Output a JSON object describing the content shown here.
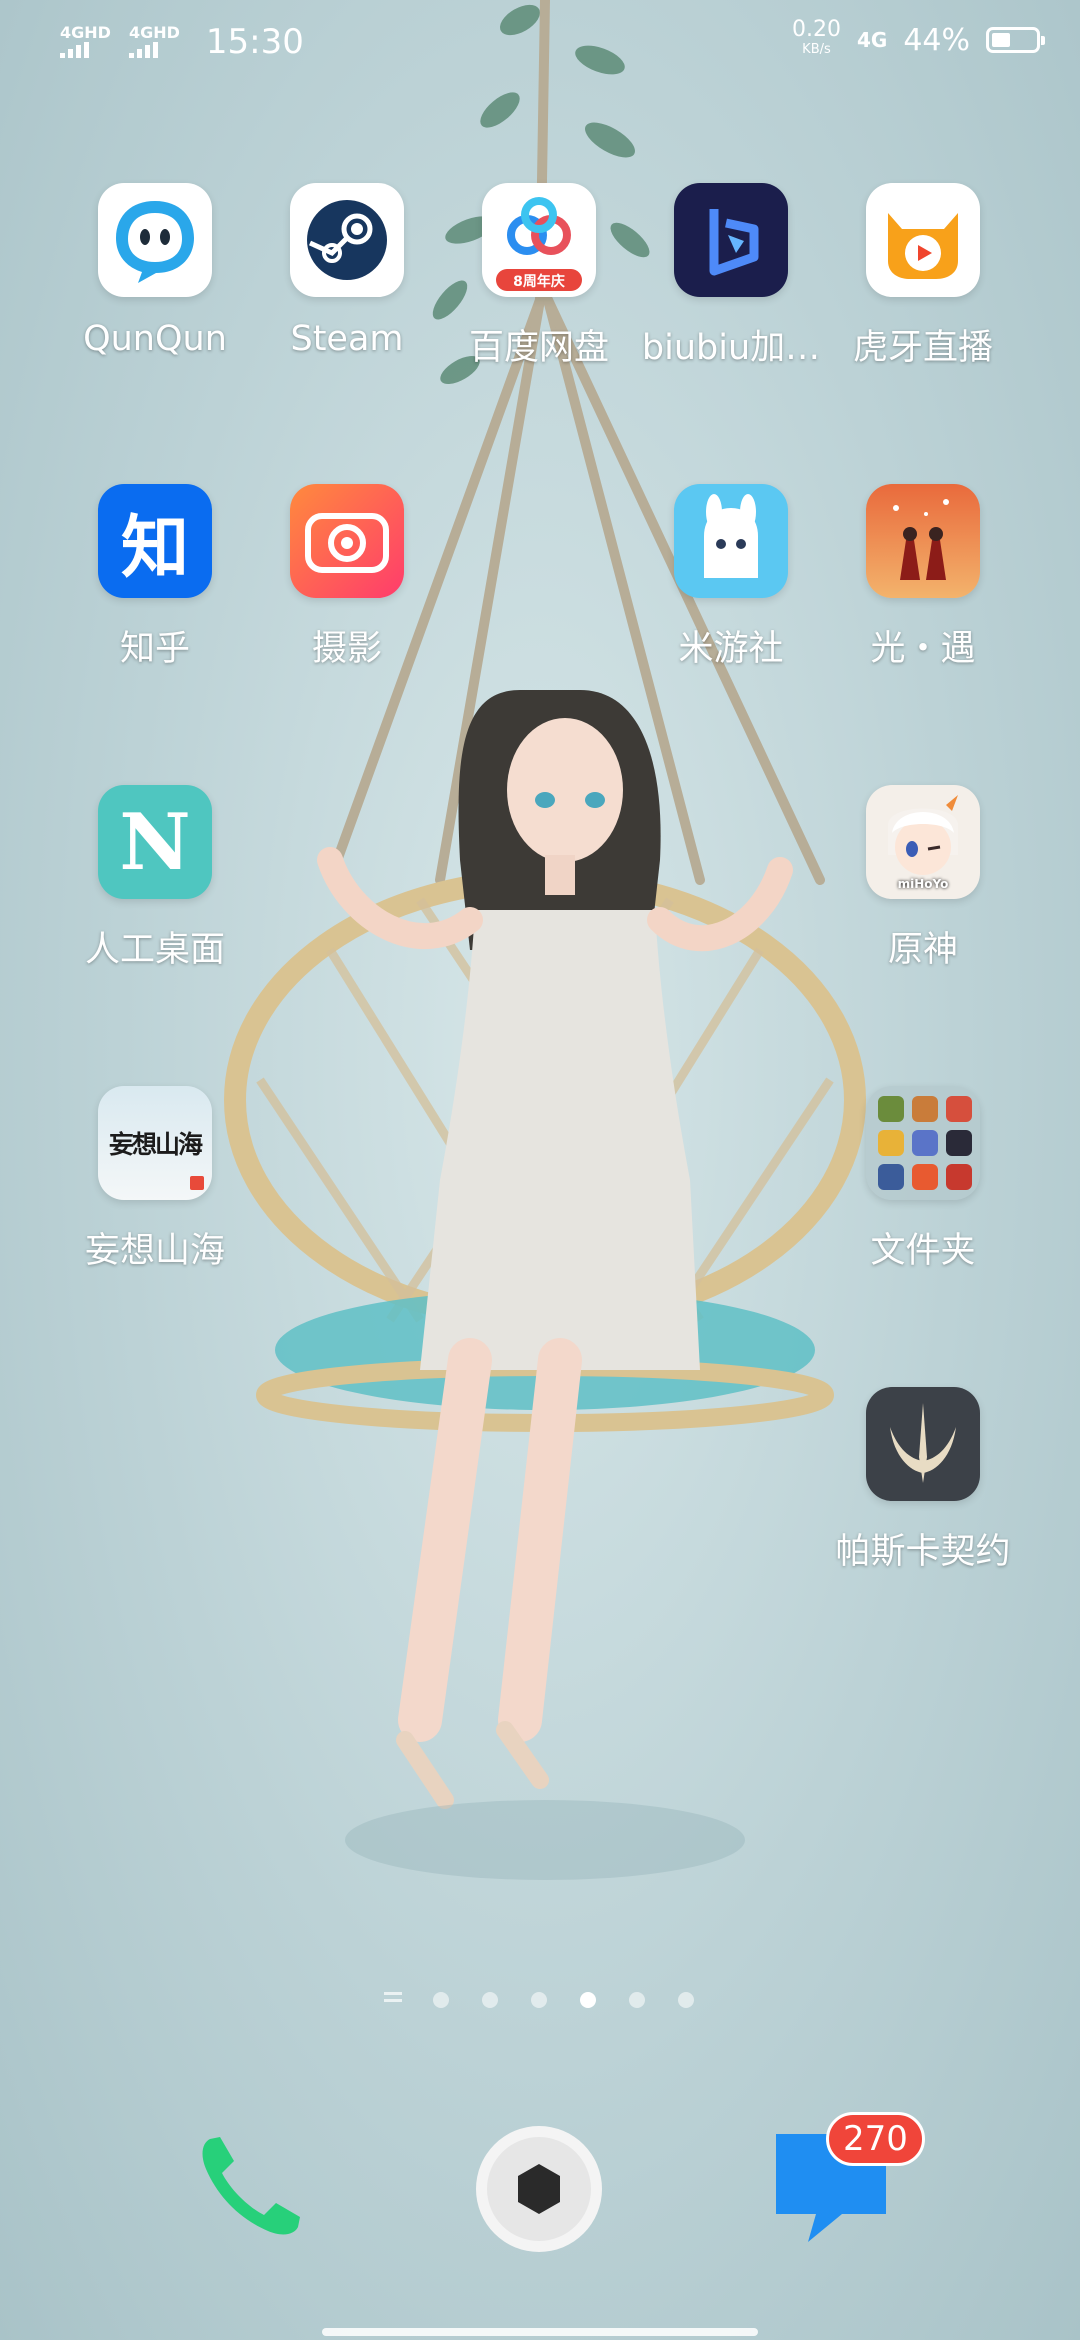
{
  "status_bar": {
    "network1": "4GHD",
    "network2": "4GHD",
    "time": "15:30",
    "speed_value": "0.20",
    "speed_unit": "KB/s",
    "network3": "4G",
    "battery_percent": "44%",
    "battery_level": 0.44
  },
  "apps": [
    {
      "label": "QunQun",
      "icon": "qunqun-icon"
    },
    {
      "label": "Steam",
      "icon": "steam-icon"
    },
    {
      "label": "百度网盘",
      "icon": "baidu-netdisk-icon",
      "badge_text": "8周年庆"
    },
    {
      "label": "biubiu加…",
      "icon": "biubiu-icon"
    },
    {
      "label": "虎牙直播",
      "icon": "huya-icon"
    },
    {
      "label": "知乎",
      "icon": "zhihu-icon",
      "icon_text": "知"
    },
    {
      "label": "摄影",
      "icon": "camera-icon"
    },
    {
      "label": "米游社",
      "icon": "miyoushe-icon"
    },
    {
      "label": "光・遇",
      "icon": "sky-icon"
    },
    {
      "label": "人工桌面",
      "icon": "artificial-desktop-icon",
      "icon_text": "N"
    },
    {
      "label": "原神",
      "icon": "genshin-icon",
      "icon_text": "miHoYo"
    },
    {
      "label": "妄想山海",
      "icon": "wangxiang-shanhai-icon",
      "icon_text": "妄想山海"
    },
    {
      "label": "文件夹",
      "icon": "folder-icon"
    },
    {
      "label": "帕斯卡契约",
      "icon": "pascal-contract-icon"
    }
  ],
  "page_indicator": {
    "pages": 6,
    "active": 4
  },
  "dock": {
    "phone": "phone-icon",
    "camera": "shutter-icon",
    "messages": "messages-icon",
    "messages_badge": "270"
  }
}
